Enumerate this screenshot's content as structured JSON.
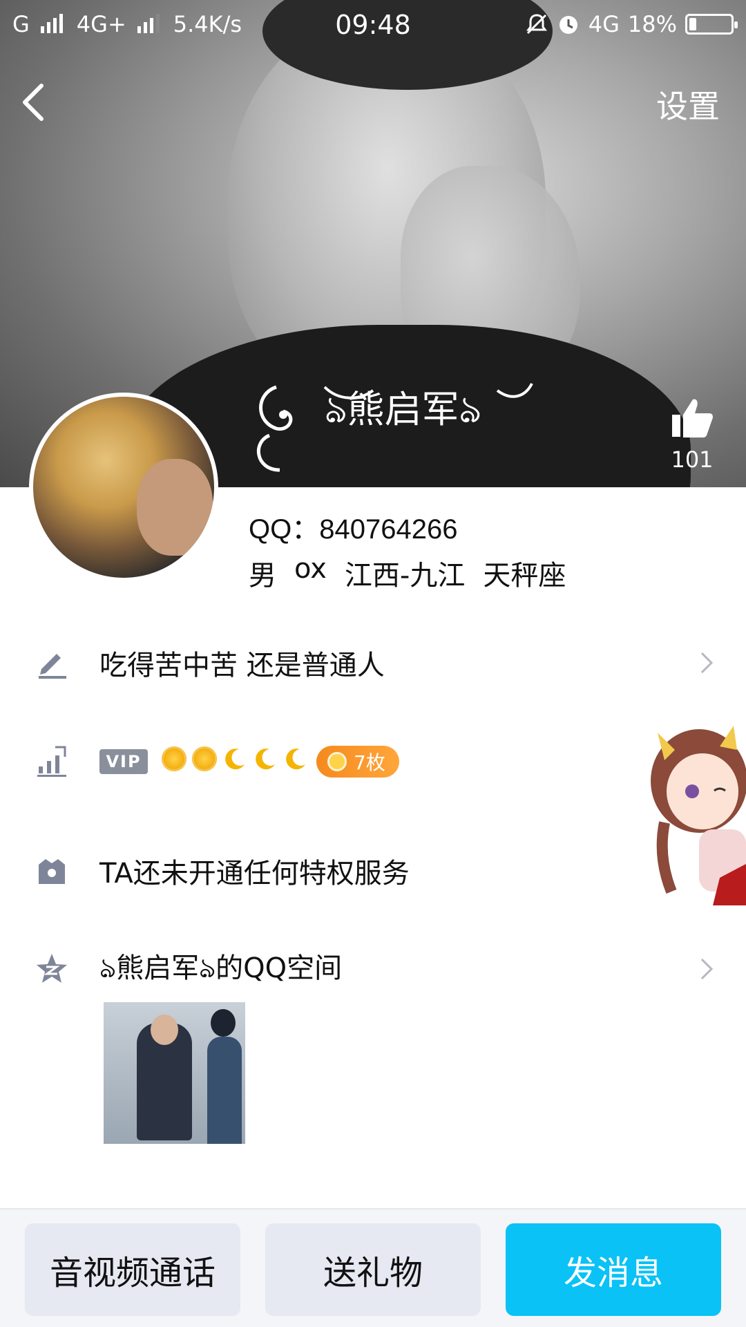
{
  "status_bar": {
    "carrier1": "G",
    "carrier2": "4G+",
    "speed": "5.4K/s",
    "time": "09:48",
    "network": "4G",
    "battery_percent": "18%",
    "battery_level": 0.18
  },
  "header": {
    "settings_label": "设置",
    "nickname": "ঌ熊启军ঌ",
    "likes": "101"
  },
  "profile": {
    "qq_label": "QQ：840764266",
    "gender": "男",
    "age": "ox",
    "location": "江西-九江",
    "constellation": "天秤座"
  },
  "rows": {
    "signature": "吃得苦中苦  还是普通人",
    "vip_badge": "VIP",
    "medal_label": "7枚",
    "privilege": "TA还未开通任何特权服务",
    "qzone": "ঌ熊启军ঌ的QQ空间"
  },
  "icons": {
    "back": "chevron-left-icon",
    "like": "thumbs-up-icon",
    "signature": "pencil-icon",
    "level": "level-chart-icon",
    "privilege": "crown-icon",
    "qzone": "qzone-star-icon"
  },
  "bottom_bar": {
    "call": "音视频通话",
    "gift": "送礼物",
    "message": "发消息"
  },
  "colors": {
    "accent": "#0ac2f5",
    "medal": "#f58a1d",
    "icon_gray": "#7f8599"
  }
}
